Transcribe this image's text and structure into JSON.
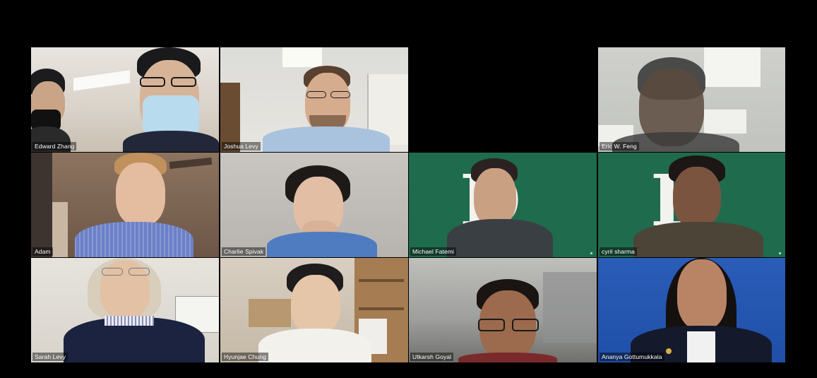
{
  "participants": [
    {
      "name": "Edward Zhang"
    },
    {
      "name": "Joshua Levy"
    },
    {
      "name": ""
    },
    {
      "name": "Eric W. Feng"
    },
    {
      "name": "Adam"
    },
    {
      "name": "Charlie Spivak"
    },
    {
      "name": "Michael Fatemi"
    },
    {
      "name": "cyril sharma"
    },
    {
      "name": "Sarah Levy"
    },
    {
      "name": "Hyunjae Chung"
    },
    {
      "name": "Utkarsh Goyal"
    },
    {
      "name": "Ananya Gottumukkala"
    }
  ],
  "colors": {
    "background": "#000000",
    "virtual_bg_green": "#1f6b4d",
    "ananya_bg_blue": "#1f4fa8"
  }
}
